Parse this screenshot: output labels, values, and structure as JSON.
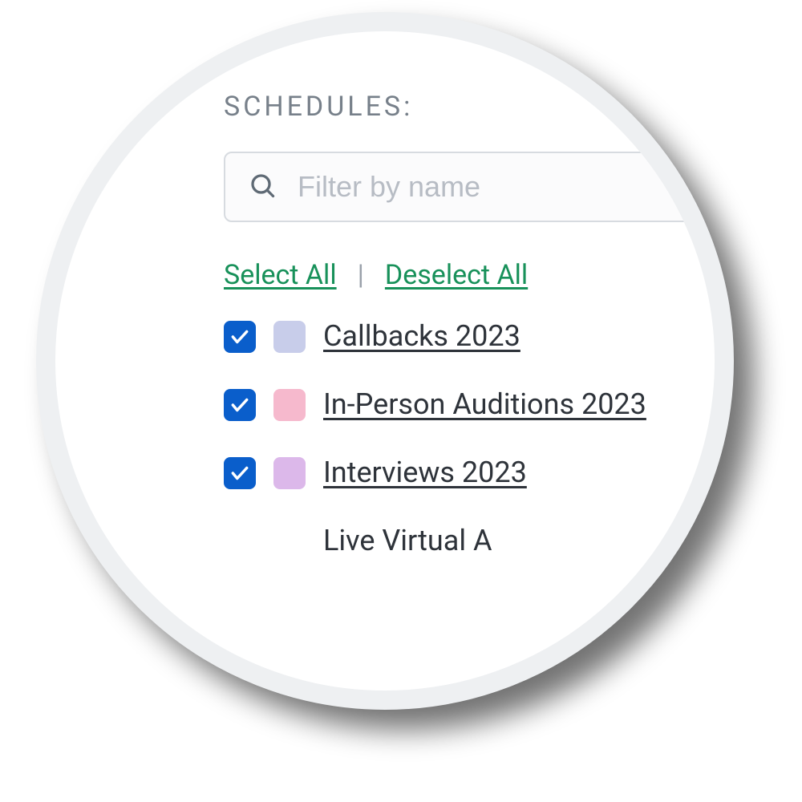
{
  "section_label": "SCHEDULES:",
  "search": {
    "placeholder": "Filter by name",
    "value": ""
  },
  "actions": {
    "select_all": "Select All",
    "separator": "|",
    "deselect_all": "Deselect All"
  },
  "items": [
    {
      "label": "Callbacks 2023",
      "checked": true,
      "color": "#c8cdea"
    },
    {
      "label": "In-Person Auditions 2023",
      "checked": true,
      "color": "#f6b9cd"
    },
    {
      "label": "Interviews 2023",
      "checked": true,
      "color": "#dcb8ea"
    }
  ],
  "partial_item_label": "Live Virtual A",
  "colors": {
    "accent_link": "#18915a",
    "checkbox_bg": "#0a5ecb"
  }
}
